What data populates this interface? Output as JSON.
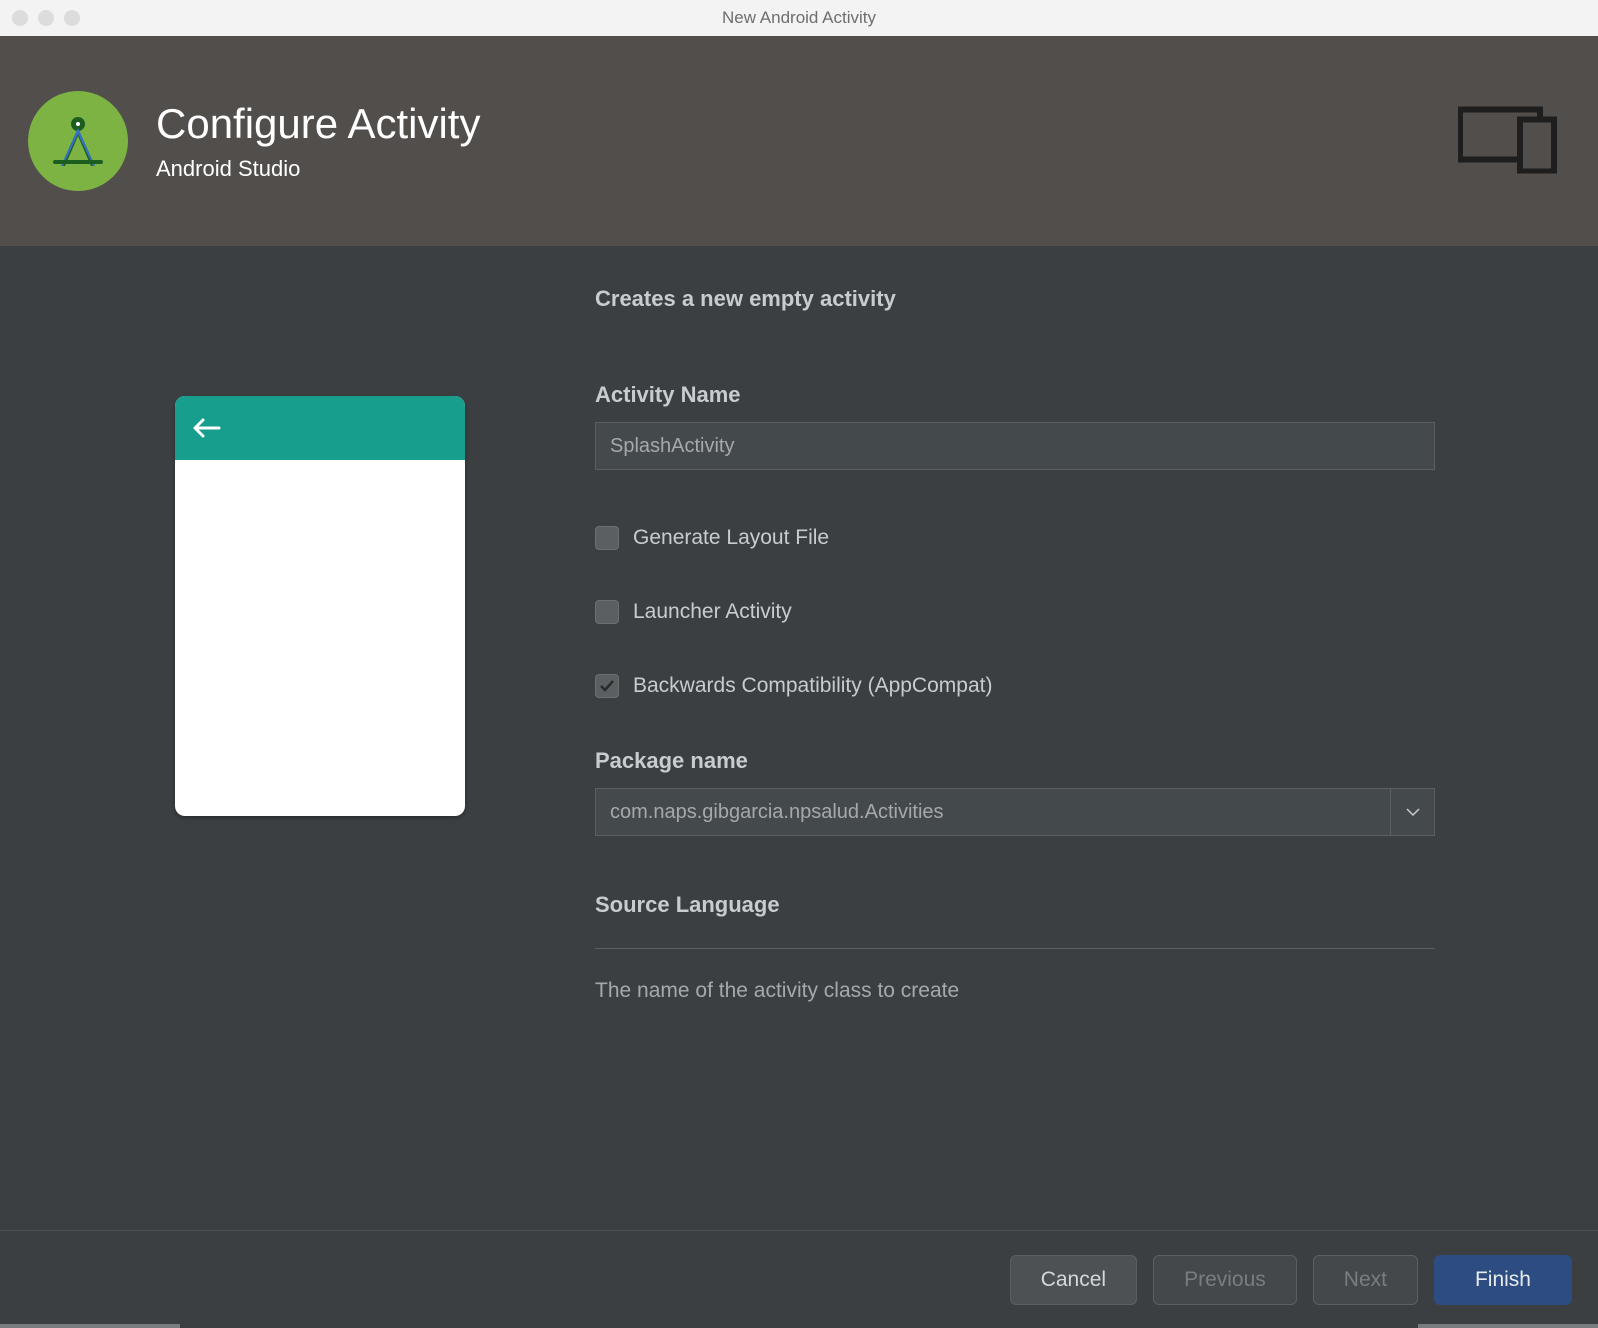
{
  "window": {
    "title": "New Android Activity"
  },
  "header": {
    "title": "Configure Activity",
    "subtitle": "Android Studio"
  },
  "form": {
    "description": "Creates a new empty activity",
    "activityName": {
      "label": "Activity Name",
      "value": "SplashActivity"
    },
    "generateLayout": {
      "label": "Generate Layout File",
      "checked": false
    },
    "launcherActivity": {
      "label": "Launcher Activity",
      "checked": false
    },
    "backwardsCompat": {
      "label": "Backwards Compatibility (AppCompat)",
      "checked": true
    },
    "packageName": {
      "label": "Package name",
      "value": "com.naps.gibgarcia.npsalud.Activities"
    },
    "sourceLanguage": {
      "label": "Source Language"
    },
    "hint": "The name of the activity class to create"
  },
  "footer": {
    "cancel": "Cancel",
    "previous": "Previous",
    "next": "Next",
    "finish": "Finish"
  }
}
